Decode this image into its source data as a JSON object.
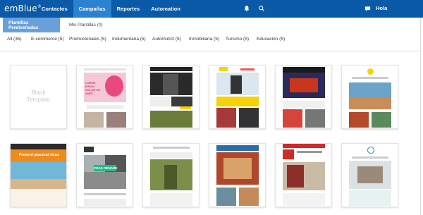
{
  "app": {
    "logo": "emBlue",
    "logo_mark": "®"
  },
  "nav": {
    "items": [
      "Contactos",
      "Campañas",
      "Reportes",
      "Automation"
    ],
    "active_index": 1,
    "greeting": "Hola"
  },
  "icons": {
    "bell": "bell-icon",
    "search": "search-icon",
    "chat": "chat-icon"
  },
  "subtabs": {
    "predesigned": "Plantillas Prediseñadas",
    "mine": "Mis Plantillas (0)"
  },
  "filters": [
    "All (35)",
    "E-commerce (5)",
    "Promocionales (5)",
    "Indumentaria (5)",
    "Automotriz (5)",
    "Inmobiliaria (5)",
    "Turismo (5)",
    "Educación (5)"
  ],
  "cards": {
    "blank": [
      "Blank",
      "Template"
    ],
    "texts": {
      "r1c2_headline": "LOREM IPSUM DOLOR SIT AMET",
      "r2c1_headline": "Present placerat risus",
      "r2c2_badge": "CRAS ORNARE"
    }
  },
  "colors": {
    "topbar": "#0a5aa8",
    "active_nav": "#2b82d0",
    "active_subtab": "#6aa0da"
  }
}
